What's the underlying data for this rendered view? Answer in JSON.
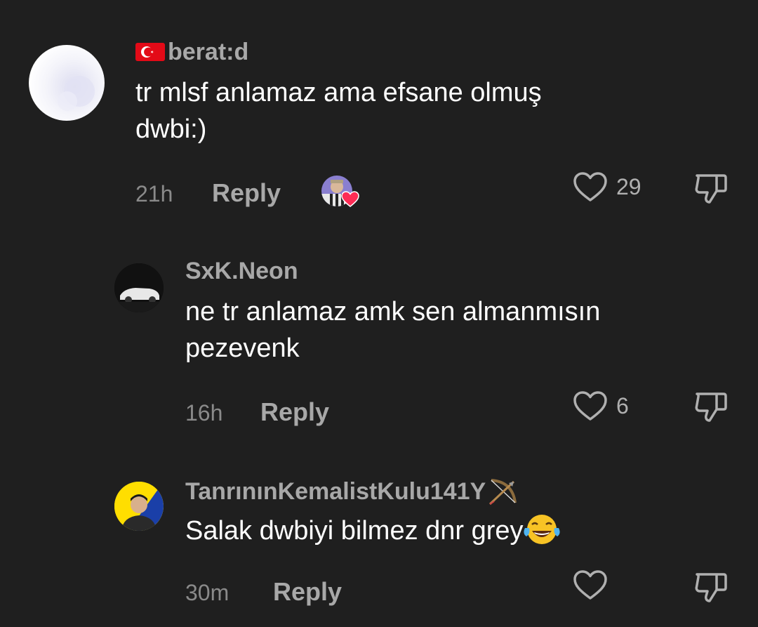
{
  "comments": [
    {
      "username": "berat:d",
      "flag": "TR",
      "text_lines": [
        "tr mlsf anlamaz ama efsane olmuş",
        "dwbi:)"
      ],
      "time": "21h",
      "reply_label": "Reply",
      "likes": "29",
      "creator_liked": true
    },
    {
      "username": "SxK.Neon",
      "text_lines": [
        "ne tr anlamaz amk sen almanmısın",
        "pezevenk"
      ],
      "time": "16h",
      "reply_label": "Reply",
      "likes": "6"
    },
    {
      "username": "TanrınınKemalistKulu141Y",
      "username_emoji": "bow-and-arrow",
      "text_lines": [
        "Salak dwbiyi bilmez dnr grey"
      ],
      "text_emoji": "face-with-tears-of-joy",
      "time": "30m",
      "reply_label": "Reply",
      "likes": ""
    }
  ],
  "icons": {
    "like": "heart-outline-icon",
    "dislike": "thumbs-down-outline-icon"
  },
  "colors": {
    "background": "#1f1f1f",
    "username": "#a8a8a8",
    "text": "#ffffff",
    "meta": "#8a8a8a"
  }
}
